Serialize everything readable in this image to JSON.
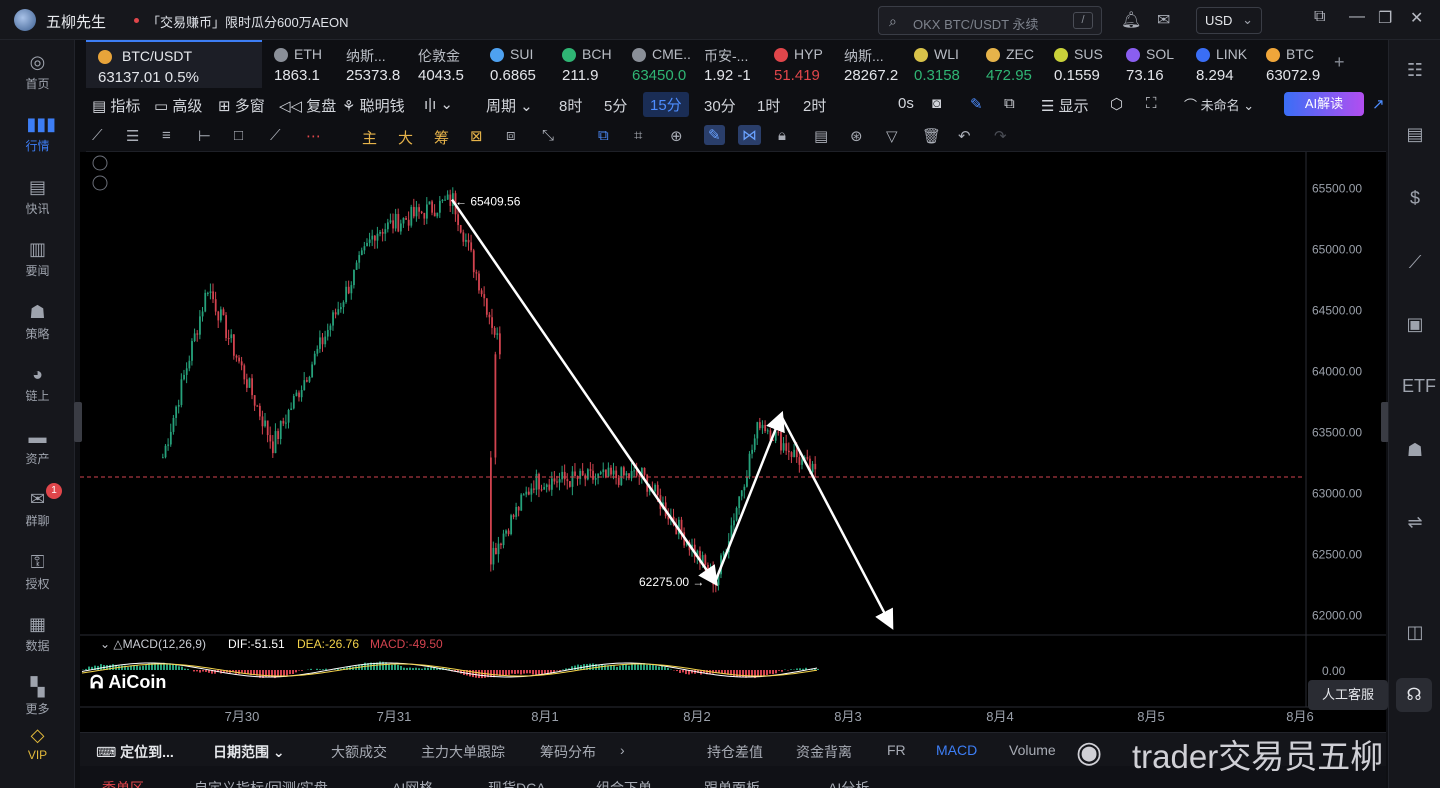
{
  "app": {
    "name": "五柳先生",
    "promo": "「交易赚币」限时瓜分600万AEON"
  },
  "search": {
    "placeholder": "OKX BTC/USDT 永续",
    "shortcut": "/"
  },
  "currency": "USD",
  "nav": [
    {
      "label": "首页",
      "icon": "home-icon"
    },
    {
      "label": "行情",
      "icon": "chart-bars-icon",
      "active": true
    },
    {
      "label": "快讯",
      "icon": "news-flash-icon"
    },
    {
      "label": "要闻",
      "icon": "document-icon"
    },
    {
      "label": "策略",
      "icon": "robot-icon"
    },
    {
      "label": "链上",
      "icon": "onchain-icon"
    },
    {
      "label": "资产",
      "icon": "wallet-icon"
    },
    {
      "label": "群聊",
      "icon": "chat-icon",
      "badge": "1"
    },
    {
      "label": "授权",
      "icon": "key-icon"
    },
    {
      "label": "数据",
      "icon": "data-icon"
    },
    {
      "label": "更多",
      "icon": "grid-icon"
    },
    {
      "label": "VIP",
      "icon": "vip-diamond-icon"
    }
  ],
  "tickers": [
    {
      "name": "BTC/USDT",
      "price": "63137.01",
      "change": "0.5%"
    },
    {
      "name": "ETH",
      "price": "1863.1"
    },
    {
      "name": "纳斯...",
      "price": "25373.8"
    },
    {
      "name": "伦敦金",
      "price": "4043.5"
    },
    {
      "name": "SUI",
      "price": "0.6865"
    },
    {
      "name": "BCH",
      "price": "211.9"
    },
    {
      "name": "CME...",
      "price": "63450.0"
    },
    {
      "name": "币安-...",
      "price": "1.92 -1"
    },
    {
      "name": "HYP",
      "price": "51.419"
    },
    {
      "name": "纳斯...",
      "price": "28267.2"
    },
    {
      "name": "WLI",
      "price": "0.3158"
    },
    {
      "name": "ZEC",
      "price": "472.95"
    },
    {
      "name": "SUS",
      "price": "0.1559"
    },
    {
      "name": "SOL",
      "price": "73.16"
    },
    {
      "name": "LINK",
      "price": "8.294"
    },
    {
      "name": "BTC",
      "price": "63072.9"
    }
  ],
  "toolbar": {
    "indicator": "指标",
    "advanced": "高级",
    "multi": "多窗",
    "replay": "复盘",
    "smart": "聪明钱",
    "period": "周期",
    "intervals": [
      "8时",
      "5分",
      "15分",
      "30分",
      "1时",
      "2时"
    ],
    "selected_interval": "15分",
    "countdown": "0s",
    "display": "显示",
    "unnamed": "未命名",
    "ai": "AI解读"
  },
  "drawbar": {
    "main": "主",
    "big": "大",
    "chip": "筹"
  },
  "chart": {
    "indicator_label": "MACD(12,26,9)",
    "dif": "DIF:-51.51",
    "dea": "DEA:-26.76",
    "macd": "MACD:-49.50",
    "high_label": "← 65409.56",
    "low_label": "62275.00 →",
    "logo": "AiCoin",
    "colors": {
      "up": "#26a17b",
      "down": "#d2434f",
      "arrow": "#ffffff",
      "dif": "#ffffff",
      "dea": "#f3d34a"
    }
  },
  "chart_data": {
    "type": "candlestick",
    "symbol": "BTC/USDT",
    "interval": "15分",
    "y_ticks": [
      "65500.00",
      "65000.00",
      "64500.00",
      "64000.00",
      "63500.00",
      "63000.00",
      "62500.00",
      "62000.00"
    ],
    "ylim": [
      61850,
      65800
    ],
    "x_ticks": [
      "7月30",
      "7月31",
      "8月1",
      "8月2",
      "8月3",
      "8月4",
      "8月5",
      "8月6"
    ],
    "macd_zero_tick": "0.00",
    "current_price": 63137.01,
    "path_points": [
      {
        "x": "7月30",
        "y": 63300
      },
      {
        "x": "7月30",
        "y": 64700
      },
      {
        "x": "7月30",
        "y": 63400
      },
      {
        "x": "7月31",
        "y": 65150
      },
      {
        "x": "7月31",
        "y": 65409.56
      },
      {
        "x": "7月31",
        "y": 64200
      },
      {
        "x": "8月1",
        "y": 62500
      },
      {
        "x": "8月1",
        "y": 63100
      },
      {
        "x": "8月2",
        "y": 63150
      },
      {
        "x": "8月2",
        "y": 62275
      },
      {
        "x": "8月2",
        "y": 63600
      },
      {
        "x": "8月2",
        "y": 63130
      }
    ],
    "annotations": [
      {
        "type": "arrow",
        "from": {
          "x": "7月31",
          "y": 65409.56
        },
        "to": {
          "x": "8月2",
          "y": 62275
        }
      },
      {
        "type": "arrow",
        "from": {
          "x": "8月2",
          "y": 62275
        },
        "to": {
          "x": "8月2",
          "y": 63640
        }
      },
      {
        "type": "arrow",
        "from": {
          "x": "8月2",
          "y": 63640
        },
        "to": {
          "x": "8月3",
          "y": 61920
        }
      }
    ]
  },
  "bottom_tabs": [
    "定位到...",
    "日期范围",
    "大额成交",
    "主力大单跟踪",
    "筹码分布",
    "持仓差值",
    "资金背离",
    "FR",
    "MACD",
    "Volume"
  ],
  "lower_tabs": [
    "委单区",
    "自定义指标/回测/实盘",
    "AI网格",
    "现货DCA",
    "组合下单",
    "跟单面板",
    "AI分析"
  ],
  "service": "人工客服",
  "watermark": "trader交易员五柳"
}
